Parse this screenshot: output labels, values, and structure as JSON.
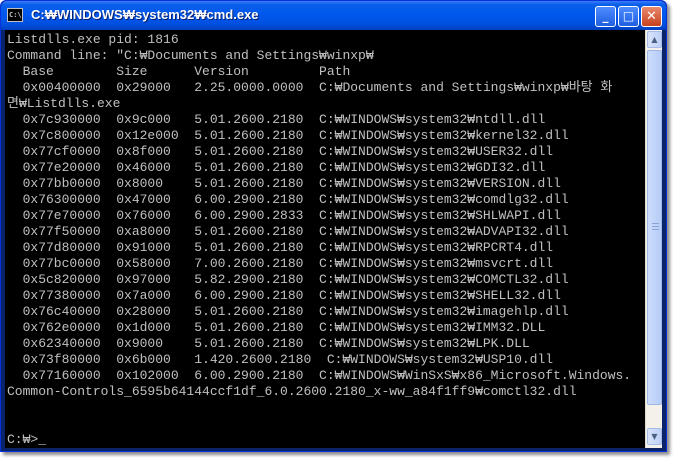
{
  "window": {
    "title": "C:₩WINDOWS₩system32₩cmd.exe",
    "icon_label": "C:\\",
    "minimize_glyph": "_",
    "maximize_glyph": "□",
    "close_glyph": "✕"
  },
  "console": {
    "lines": [
      "Listdlls.exe pid: 1816",
      "Command line: \"C:₩Documents and Settings₩winxp₩",
      "  Base        Size      Version         Path",
      "  0x00400000  0x29000   2.25.0000.0000  C:₩Documents and Settings₩winxp₩바탕 화",
      "면₩Listdlls.exe",
      "  0x7c930000  0x9c000   5.01.2600.2180  C:₩WINDOWS₩system32₩ntdll.dll",
      "  0x7c800000  0x12e000  5.01.2600.2180  C:₩WINDOWS₩system32₩kernel32.dll",
      "  0x77cf0000  0x8f000   5.01.2600.2180  C:₩WINDOWS₩system32₩USER32.dll",
      "  0x77e20000  0x46000   5.01.2600.2180  C:₩WINDOWS₩system32₩GDI32.dll",
      "  0x77bb0000  0x8000    5.01.2600.2180  C:₩WINDOWS₩system32₩VERSION.dll",
      "  0x76300000  0x47000   6.00.2900.2180  C:₩WINDOWS₩system32₩comdlg32.dll",
      "  0x77e70000  0x76000   6.00.2900.2833  C:₩WINDOWS₩system32₩SHLWAPI.dll",
      "  0x77f50000  0xa8000   5.01.2600.2180  C:₩WINDOWS₩system32₩ADVAPI32.dll",
      "  0x77d80000  0x91000   5.01.2600.2180  C:₩WINDOWS₩system32₩RPCRT4.dll",
      "  0x77bc0000  0x58000   7.00.2600.2180  C:₩WINDOWS₩system32₩msvcrt.dll",
      "  0x5c820000  0x97000   5.82.2900.2180  C:₩WINDOWS₩system32₩COMCTL32.dll",
      "  0x77380000  0x7a000   6.00.2900.2180  C:₩WINDOWS₩system32₩SHELL32.dll",
      "  0x76c40000  0x28000   5.01.2600.2180  C:₩WINDOWS₩system32₩imagehlp.dll",
      "  0x762e0000  0x1d000   5.01.2600.2180  C:₩WINDOWS₩system32₩IMM32.DLL",
      "  0x62340000  0x9000    5.01.2600.2180  C:₩WINDOWS₩system32₩LPK.DLL",
      "  0x73f80000  0x6b000   1.420.2600.2180  C:₩WINDOWS₩system32₩USP10.dll",
      "  0x77160000  0x102000  6.00.2900.2180  C:₩WINDOWS₩WinSxS₩x86_Microsoft.Windows.",
      "Common-Controls_6595b64144ccf1df_6.0.2600.2180_x-ww_a84f1ff9₩comctl32.dll",
      "",
      "",
      "C:₩>"
    ],
    "cursor": "_"
  },
  "scrollbar": {
    "up_glyph": "▲",
    "down_glyph": "▼"
  },
  "colors": {
    "console_bg": "#000000",
    "console_fg": "#c0c0c0",
    "titlebar": "#0054e3"
  }
}
